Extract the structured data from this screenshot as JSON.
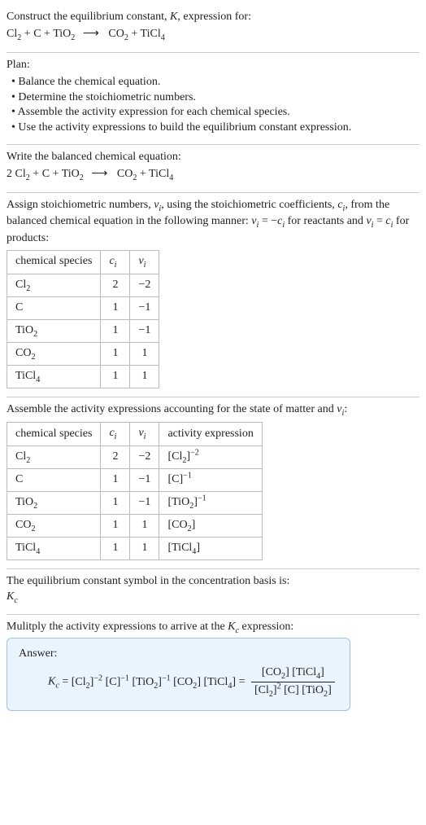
{
  "intro": {
    "line1": "Construct the equilibrium constant, ",
    "Ksym": "K",
    "line1b": ", expression for:",
    "eq_lhs_cl2": "Cl",
    "eq_plus": " + ",
    "eq_c": "C",
    "eq_tio2_a": "TiO",
    "eq_arrow": "⟶",
    "eq_co2_a": "CO",
    "eq_ticl4_a": "TiCl"
  },
  "plan": {
    "heading": "Plan:",
    "items": [
      "Balance the chemical equation.",
      "Determine the stoichiometric numbers.",
      "Assemble the activity expression for each chemical species.",
      "Use the activity expressions to build the equilibrium constant expression."
    ]
  },
  "balanced": {
    "heading": "Write the balanced chemical equation:",
    "coef2": "2 ",
    "cl2": "Cl",
    "plus": " + ",
    "c": "C",
    "tio2": "TiO",
    "arrow": "⟶",
    "co2": "CO",
    "ticl4": "TiCl"
  },
  "stoich": {
    "text_a": "Assign stoichiometric numbers, ",
    "nu": "ν",
    "text_b": ", using the stoichiometric coefficients, ",
    "c": "c",
    "text_c": ", from the balanced chemical equation in the following manner: ",
    "eq1": " = −",
    "text_d": " for reactants and ",
    "eq2": " = ",
    "text_e": " for products:",
    "headers": {
      "species": "chemical species",
      "ci": "c",
      "vi": "ν"
    },
    "rows": [
      {
        "sp_a": "Cl",
        "sp_sub": "2",
        "ci": "2",
        "vi": "−2"
      },
      {
        "sp_a": "C",
        "sp_sub": "",
        "ci": "1",
        "vi": "−1"
      },
      {
        "sp_a": "TiO",
        "sp_sub": "2",
        "ci": "1",
        "vi": "−1"
      },
      {
        "sp_a": "CO",
        "sp_sub": "2",
        "ci": "1",
        "vi": "1"
      },
      {
        "sp_a": "TiCl",
        "sp_sub": "4",
        "ci": "1",
        "vi": "1"
      }
    ]
  },
  "activity": {
    "heading": "Assemble the activity expressions accounting for the state of matter and ",
    "nu": "ν",
    "colon": ":",
    "headers": {
      "species": "chemical species",
      "ci": "c",
      "vi": "ν",
      "act": "activity expression"
    },
    "rows": [
      {
        "sp_a": "Cl",
        "sp_sub": "2",
        "ci": "2",
        "vi": "−2",
        "act_a": "[Cl",
        "act_sub": "2",
        "act_b": "]",
        "act_exp": "−2"
      },
      {
        "sp_a": "C",
        "sp_sub": "",
        "ci": "1",
        "vi": "−1",
        "act_a": "[C",
        "act_sub": "",
        "act_b": "]",
        "act_exp": "−1"
      },
      {
        "sp_a": "TiO",
        "sp_sub": "2",
        "ci": "1",
        "vi": "−1",
        "act_a": "[TiO",
        "act_sub": "2",
        "act_b": "]",
        "act_exp": "−1"
      },
      {
        "sp_a": "CO",
        "sp_sub": "2",
        "ci": "1",
        "vi": "1",
        "act_a": "[CO",
        "act_sub": "2",
        "act_b": "]",
        "act_exp": ""
      },
      {
        "sp_a": "TiCl",
        "sp_sub": "4",
        "ci": "1",
        "vi": "1",
        "act_a": "[TiCl",
        "act_sub": "4",
        "act_b": "]",
        "act_exp": ""
      }
    ]
  },
  "kc_symbol": {
    "line": "The equilibrium constant symbol in the concentration basis is:",
    "K": "K",
    "c": "c"
  },
  "multiply": {
    "line_a": "Mulitply the activity expressions to arrive at the ",
    "K": "K",
    "c": "c",
    "line_b": " expression:"
  },
  "answer": {
    "label": "Answer:",
    "K": "K",
    "c": "c",
    "eq": " = ",
    "t1_a": "[Cl",
    "t1_sub": "2",
    "t1_b": "]",
    "t1_exp": "−2",
    "t2_a": "[C",
    "t2_b": "]",
    "t2_exp": "−1",
    "t3_a": "[TiO",
    "t3_sub": "2",
    "t3_b": "]",
    "t3_exp": "−1",
    "t4_a": "[CO",
    "t4_sub": "2",
    "t4_b": "]",
    "t5_a": "[TiCl",
    "t5_sub": "4",
    "t5_b": "]",
    "eq2": " = ",
    "num_a": "[CO",
    "num_a_sub": "2",
    "num_a_b": "] [TiCl",
    "num_b_sub": "4",
    "num_b_b": "]",
    "den_a": "[Cl",
    "den_a_sub": "2",
    "den_a_b": "]",
    "den_a_exp": "2",
    "den_b": " [C] [TiO",
    "den_b_sub": "2",
    "den_b_b": "]"
  }
}
